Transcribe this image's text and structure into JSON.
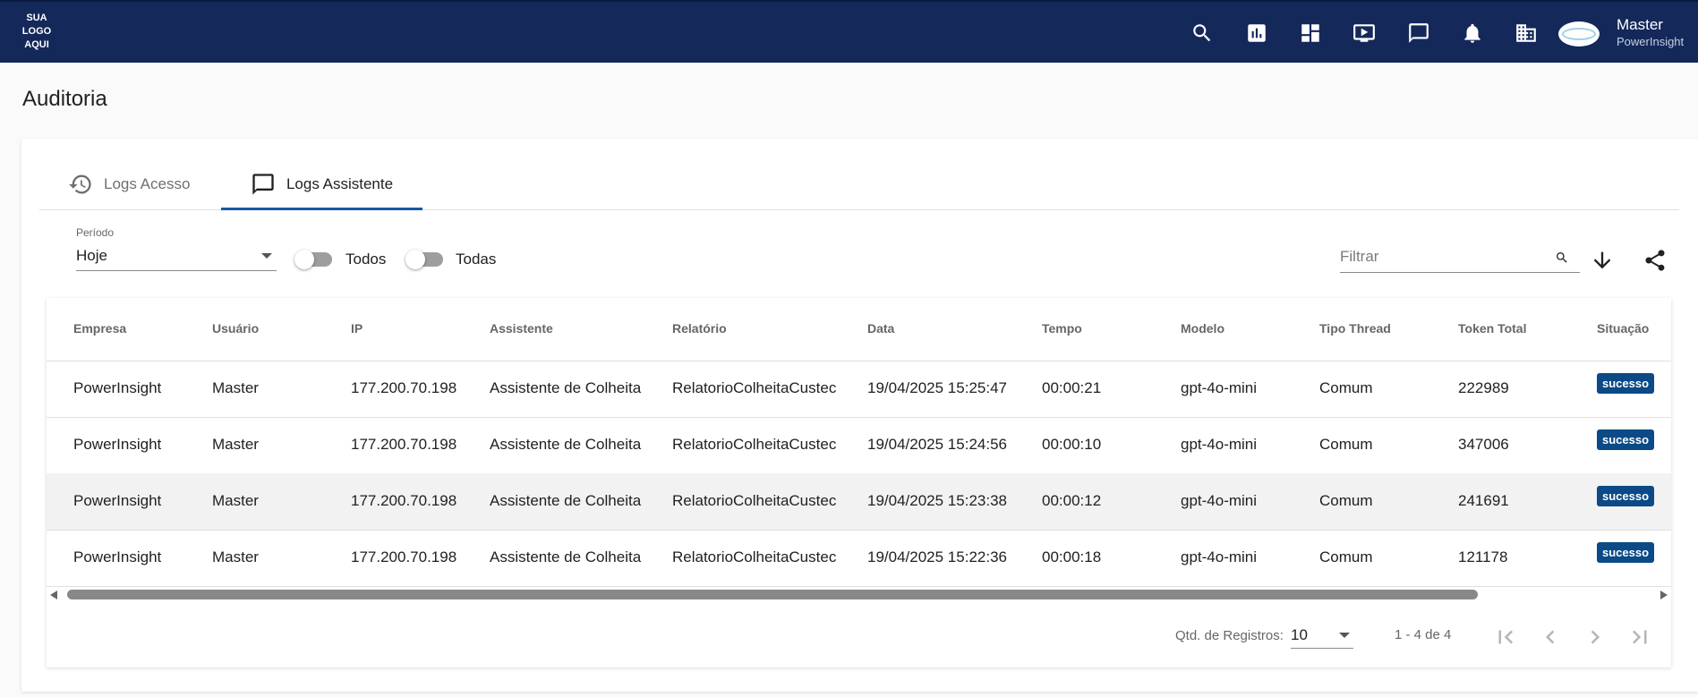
{
  "header": {
    "logo_text": "SUA LOGO AQUI",
    "icons": [
      "search-icon",
      "chart-icon",
      "dashboard-icon",
      "tv-play-icon",
      "chat-icon",
      "bell-icon",
      "building-icon"
    ],
    "user": {
      "name": "Master",
      "company": "PowerInsight"
    }
  },
  "page": {
    "title": "Auditoria"
  },
  "tabs": [
    {
      "label": "Logs Acesso",
      "icon": "history-icon",
      "active": false
    },
    {
      "label": "Logs Assistente",
      "icon": "chat-icon",
      "active": true
    }
  ],
  "filters": {
    "periodo_label": "Período",
    "periodo_value": "Hoje",
    "toggle1_label": "Todos",
    "toggle2_label": "Todas",
    "filter_placeholder": "Filtrar"
  },
  "table": {
    "columns": [
      "Empresa",
      "Usuário",
      "IP",
      "Assistente",
      "Relatório",
      "Data",
      "Tempo",
      "Modelo",
      "Tipo Thread",
      "Token Total",
      "Situação"
    ],
    "rows": [
      [
        "PowerInsight",
        "Master",
        "177.200.70.198",
        "Assistente de Colheita",
        "RelatorioColheitaCustec",
        "19/04/2025 15:25:47",
        "00:00:21",
        "gpt-4o-mini",
        "Comum",
        "222989",
        "sucesso"
      ],
      [
        "PowerInsight",
        "Master",
        "177.200.70.198",
        "Assistente de Colheita",
        "RelatorioColheitaCustec",
        "19/04/2025 15:24:56",
        "00:00:10",
        "gpt-4o-mini",
        "Comum",
        "347006",
        "sucesso"
      ],
      [
        "PowerInsight",
        "Master",
        "177.200.70.198",
        "Assistente de Colheita",
        "RelatorioColheitaCustec",
        "19/04/2025 15:23:38",
        "00:00:12",
        "gpt-4o-mini",
        "Comum",
        "241691",
        "sucesso"
      ],
      [
        "PowerInsight",
        "Master",
        "177.200.70.198",
        "Assistente de Colheita",
        "RelatorioColheitaCustec",
        "19/04/2025 15:22:36",
        "00:00:18",
        "gpt-4o-mini",
        "Comum",
        "121178",
        "sucesso"
      ]
    ]
  },
  "pagination": {
    "label": "Qtd. de Registros:",
    "page_size": "10",
    "range": "1 - 4 de 4"
  },
  "colors": {
    "header_bg": "#14295a",
    "tab_indicator": "#1a57a3",
    "badge_bg": "#0b4a86"
  }
}
